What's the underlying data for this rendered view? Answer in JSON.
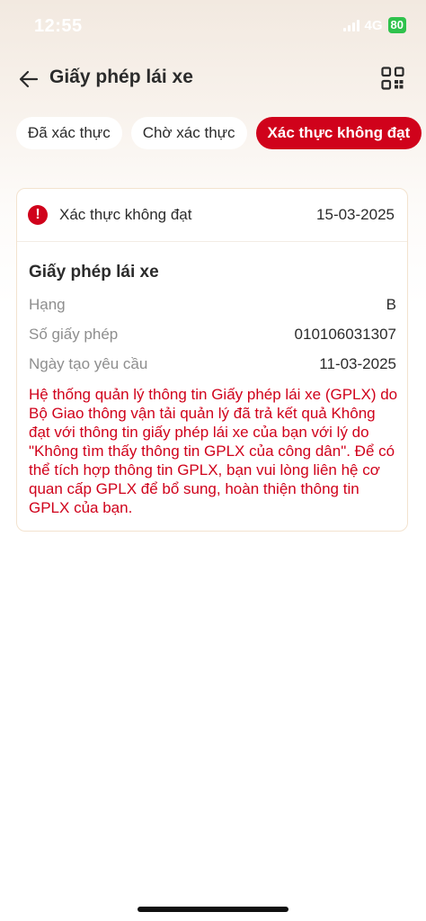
{
  "status_bar": {
    "time": "12:55",
    "network": "4G",
    "battery": "80"
  },
  "header": {
    "title": "Giấy phép lái xe",
    "back_icon": "arrow-left-icon",
    "qr_icon": "qr-code-icon"
  },
  "tabs": [
    {
      "label": "Đã xác thực",
      "active": false
    },
    {
      "label": "Chờ xác thực",
      "active": false
    },
    {
      "label": "Xác thực không đạt",
      "active": true
    }
  ],
  "card": {
    "status_label": "Xác thực không đạt",
    "status_date": "15-03-2025",
    "status_icon": "alert-circle-icon",
    "status_color": "#d0021b",
    "title": "Giấy phép lái xe",
    "rows": [
      {
        "label": "Hạng",
        "value": "B"
      },
      {
        "label": "Số giấy phép",
        "value": "010106031307"
      },
      {
        "label": "Ngày tạo yêu cầu",
        "value": "11-03-2025"
      }
    ],
    "reason": "Hệ thống quản lý thông tin Giấy phép lái xe (GPLX) do Bộ Giao thông vận tải quản lý đã trả kết quả Không đạt với thông tin giấy phép lái xe của bạn với lý do \"Không tìm thấy thông tin GPLX của công dân\". Để có thể tích hợp thông tin GPLX, bạn vui lòng liên hệ cơ quan cấp GPLX để bổ sung, hoàn thiện thông tin GPLX của bạn."
  },
  "colors": {
    "accent": "#d0021b",
    "battery": "#2fc24c"
  }
}
